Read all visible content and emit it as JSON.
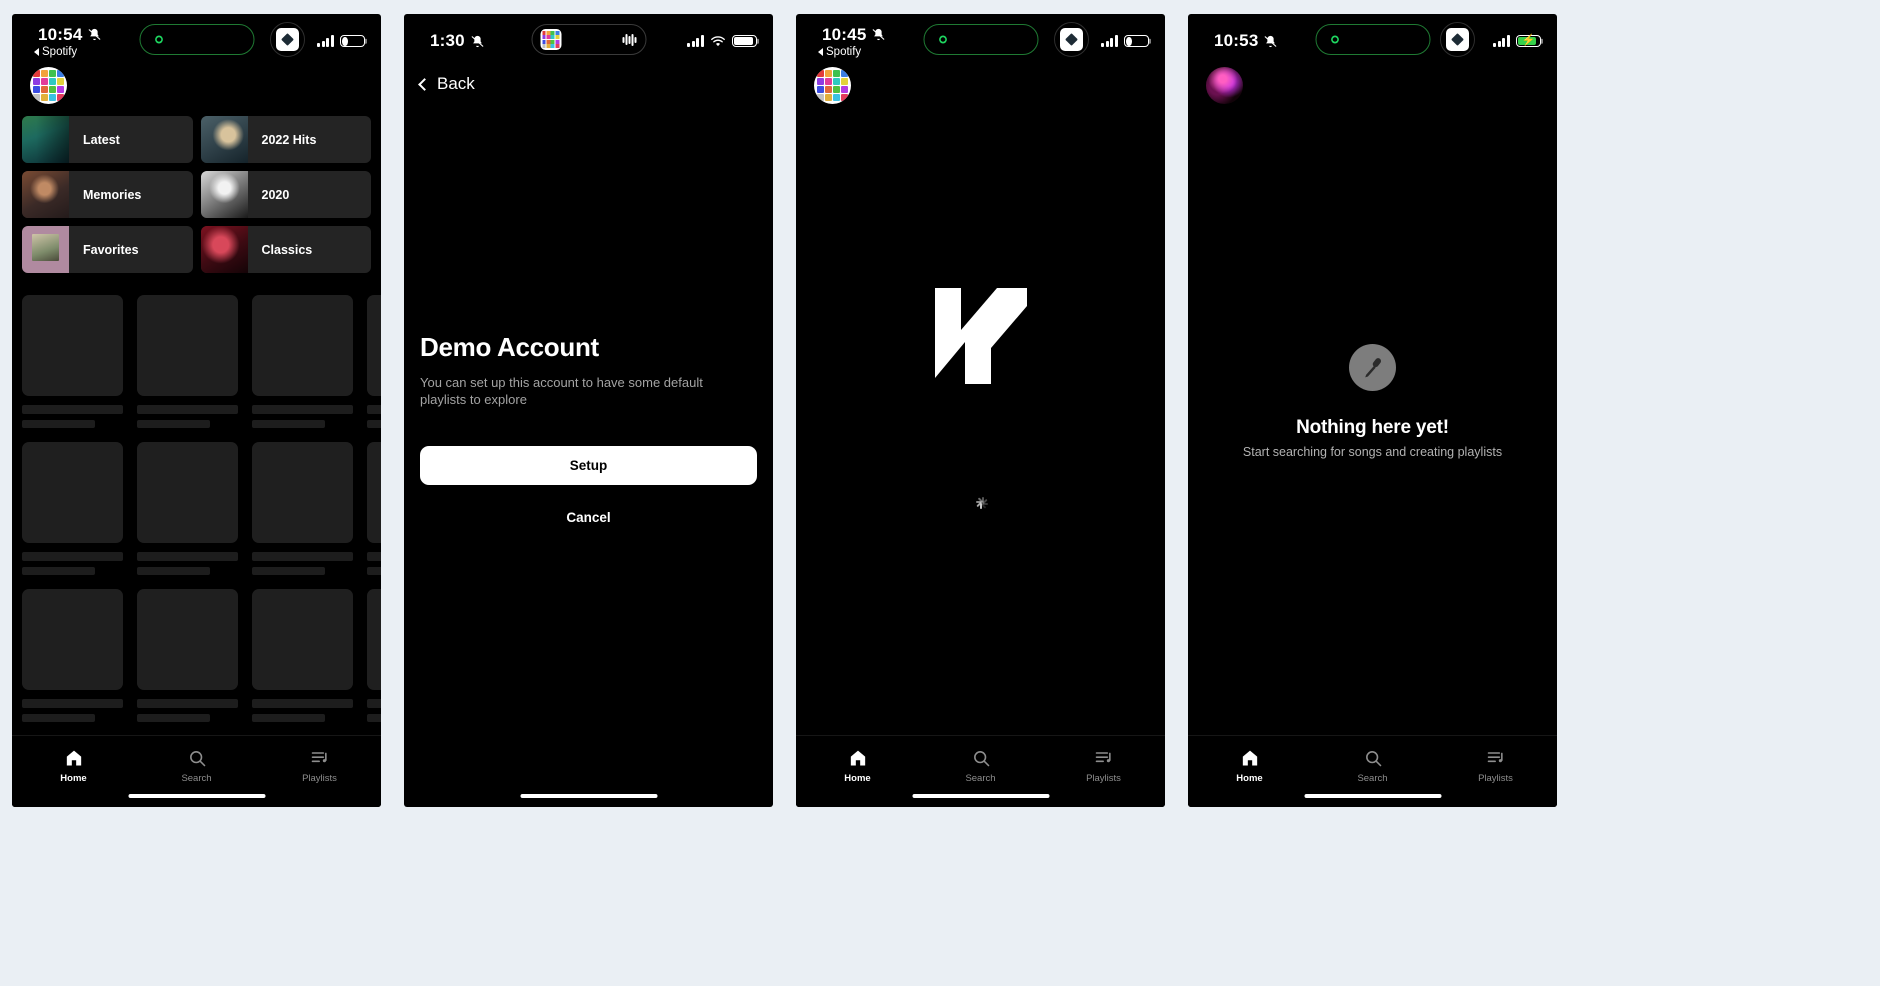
{
  "panels": [
    {
      "id": "home-playlists",
      "status": {
        "time": "10:54",
        "back_app": "Spotify",
        "silent_icon": "bell-off-icon",
        "island": "green-link-icon",
        "battery_level": 0.26,
        "battery_charging": false,
        "wifi": false
      },
      "playlists": [
        {
          "name": "Latest",
          "art": "art-latest"
        },
        {
          "name": "2022 Hits",
          "art": "art-hits"
        },
        {
          "name": "Memories",
          "art": "art-mem"
        },
        {
          "name": "2020",
          "art": "art-2020"
        },
        {
          "name": "Favorites",
          "art": "art-fav"
        },
        {
          "name": "Classics",
          "art": "art-classics"
        }
      ],
      "skeleton_rows": 3,
      "tabs": [
        {
          "label": "Home",
          "icon": "home-icon",
          "active": true
        },
        {
          "label": "Search",
          "icon": "search-icon",
          "active": false
        },
        {
          "label": "Playlists",
          "icon": "playlists-icon",
          "active": false
        }
      ]
    },
    {
      "id": "demo-account",
      "status": {
        "time": "1:30",
        "back_app": "",
        "silent_icon": "bell-off-icon",
        "island": "app-grid-icon",
        "battery_level": 0.92,
        "battery_charging": false,
        "wifi": true
      },
      "back_label": "Back",
      "title": "Demo Account",
      "subtitle": "You can set up this account to have some default playlists to explore",
      "primary_button": "Setup",
      "secondary_button": "Cancel"
    },
    {
      "id": "splash-loading",
      "status": {
        "time": "10:45",
        "back_app": "Spotify",
        "silent_icon": "bell-off-icon",
        "island": "green-link-icon",
        "battery_level": 0.22,
        "battery_charging": false,
        "wifi": false
      },
      "logo": "n-monogram-logo",
      "loading": "activity-spinner",
      "tabs": [
        {
          "label": "Home",
          "icon": "home-icon",
          "active": true
        },
        {
          "label": "Search",
          "icon": "search-icon",
          "active": false
        },
        {
          "label": "Playlists",
          "icon": "playlists-icon",
          "active": false
        }
      ]
    },
    {
      "id": "empty-playlists",
      "status": {
        "time": "10:53",
        "back_app": "",
        "silent_icon": "bell-off-icon",
        "island": "green-link-icon",
        "battery_level": 0.85,
        "battery_charging": true,
        "wifi": false
      },
      "empty_icon": "microphone-icon",
      "empty_title": "Nothing here yet!",
      "empty_subtitle": "Start searching for songs and creating playlists",
      "tabs": [
        {
          "label": "Home",
          "icon": "home-icon",
          "active": true
        },
        {
          "label": "Search",
          "icon": "search-icon",
          "active": false
        },
        {
          "label": "Playlists",
          "icon": "playlists-icon",
          "active": false
        }
      ]
    }
  ],
  "colors": {
    "background": "#eaeff4",
    "screen": "#000000",
    "card": "#242424",
    "skeleton": "#1f1f1f",
    "accent_green": "#1ed760",
    "muted_text": "#a3a3a3",
    "charging_green": "#35d04a"
  }
}
